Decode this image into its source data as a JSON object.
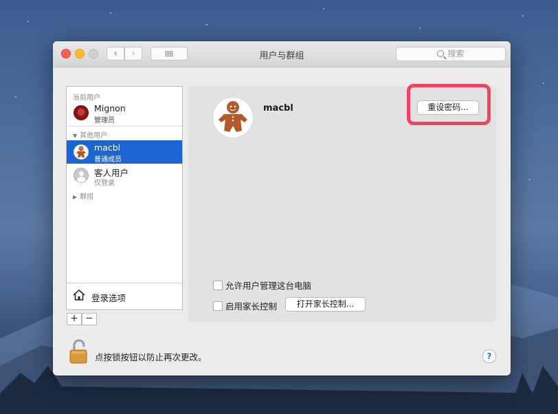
{
  "window": {
    "title": "用户与群组"
  },
  "toolbar": {
    "back_icon": "chevron-left-icon",
    "forward_icon": "chevron-right-icon",
    "grid_icon": "show-all-grid-icon"
  },
  "search": {
    "placeholder": "搜索"
  },
  "sidebar": {
    "current_user_header": "当前用户",
    "current_user": {
      "name": "Mignon",
      "role": "管理员"
    },
    "other_users_header": "其他用户",
    "other_users": [
      {
        "name": "macbl",
        "role": "普通成员",
        "selected": true
      },
      {
        "name": "客人用户",
        "role": "仅登录",
        "selected": false
      }
    ],
    "groups_header": "群组",
    "login_options": "登录选项",
    "add_label": "+",
    "remove_label": "−"
  },
  "panel": {
    "user_name": "macbl",
    "reset_password": "重设密码...",
    "allow_admin": "允许用户管理这台电脑",
    "enable_parental": "启用家长控制",
    "open_parental": "打开家长控制..."
  },
  "footer": {
    "lock_text": "点按锁按钮以防止再次更改。",
    "help": "?"
  },
  "colors": {
    "selection": "#1b64d1",
    "highlight": "#f0455f"
  }
}
